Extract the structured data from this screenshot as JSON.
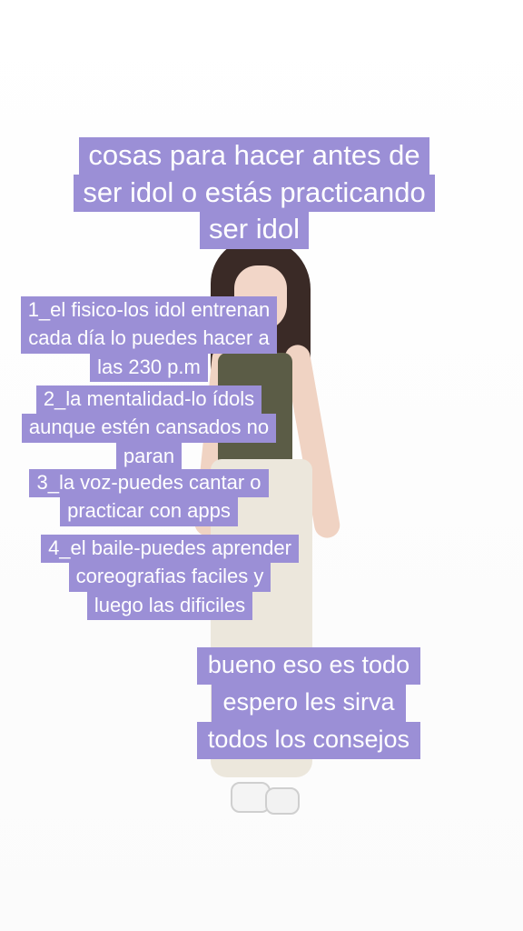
{
  "title_lines": [
    "cosas para hacer antes de",
    "ser idol o estás practicando",
    "ser idol"
  ],
  "tips": [
    [
      "1_el fisico-los idol entrenan",
      "cada día lo puedes hacer a",
      "las 230 p.m"
    ],
    [
      "2_la mentalidad-lo ídols",
      "aunque estén cansados no",
      "paran"
    ],
    [
      "3_la voz-puedes cantar o",
      "practicar con apps"
    ],
    [
      "4_el baile-puedes aprender",
      "coreografias faciles y",
      "luego las dificiles"
    ]
  ],
  "closing_lines": [
    "bueno eso es todo",
    "espero les sirva",
    "todos los consejos"
  ],
  "colors": {
    "caption_bg": "#9b8fd6",
    "caption_text": "#ffffff",
    "background": "#ffffff"
  }
}
